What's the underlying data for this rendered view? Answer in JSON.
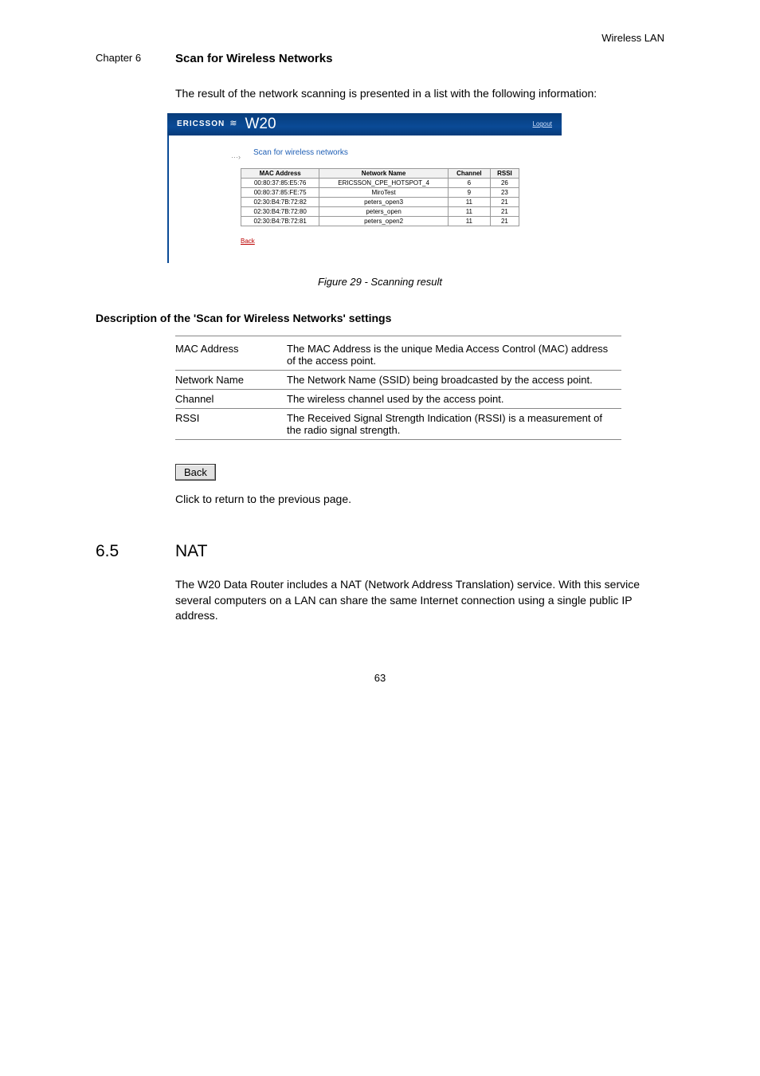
{
  "doc": {
    "header_label": "Wireless LAN",
    "chapter_num": "Chapter 6",
    "chapter_title": "Scan for Wireless Networks",
    "intro": "The result of the network scanning is presented in a list with the following information:",
    "figure_caption": "Figure 29 - Scanning result",
    "desc_section_title": "Description of the 'Scan for Wireless Networks' settings",
    "desc_rows": [
      {
        "label": "MAC Address",
        "text": "The MAC Address is the unique Media Access Control (MAC) address of the access point."
      },
      {
        "label": "Network Name",
        "text": "The Network Name (SSID) being broadcasted by the access point."
      },
      {
        "label": "Channel",
        "text": "The wireless channel used by the access point."
      },
      {
        "label": "RSSI",
        "text": "The Received Signal Strength Indication (RSSI) is a measurement of the radio signal strength."
      }
    ],
    "back_button": "Back",
    "back_text": "Click _ to return to the previous page.",
    "nat_num": "6.5",
    "nat_title": "NAT",
    "nat_para": "The W20 Data Router includes a NAT (Network Address Translation) service. With this service several computers on a LAN can share the same Internet connection using a single public IP address.",
    "page_number": "63"
  },
  "screenshot": {
    "brand": "ERICSSON",
    "model": "W20",
    "logout": "Logout",
    "title": "Scan for wireless networks",
    "back": "Back",
    "cols": [
      "MAC Address",
      "Network Name",
      "Channel",
      "RSSI"
    ],
    "rows": [
      {
        "mac": "00:80:37:85:E5:76",
        "name": "ERICSSON_CPE_HOTSPOT_4",
        "ch": "6",
        "rssi": "26"
      },
      {
        "mac": "00:80:37:85:FE:75",
        "name": "MiroTest",
        "ch": "9",
        "rssi": "23"
      },
      {
        "mac": "02:30:B4:7B:72:82",
        "name": "peters_open3",
        "ch": "11",
        "rssi": "21"
      },
      {
        "mac": "02:30:B4:7B:72:80",
        "name": "peters_open",
        "ch": "11",
        "rssi": "21"
      },
      {
        "mac": "02:30:B4:7B:72:81",
        "name": "peters_open2",
        "ch": "11",
        "rssi": "21"
      }
    ]
  }
}
